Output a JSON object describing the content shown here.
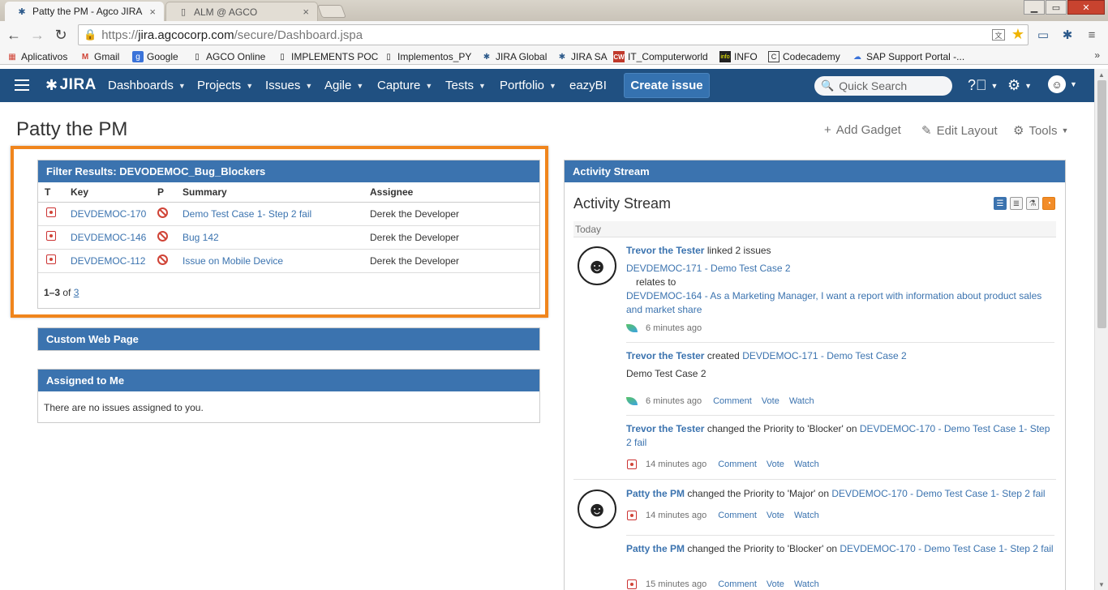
{
  "browser": {
    "tabs": [
      {
        "title": "Patty the PM - Agco JIRA",
        "close": "×"
      },
      {
        "title": "ALM @ AGCO",
        "close": "×"
      }
    ],
    "url": {
      "scheme": "https://",
      "host": "jira.agcocorp.com",
      "path": "/secure/Dashboard.jspa"
    },
    "bookmarks": [
      {
        "label": "Aplicativos",
        "icon": "apps-grid-icon"
      },
      {
        "label": "Gmail",
        "icon": "gmail-icon"
      },
      {
        "label": "Google",
        "icon": "google-icon"
      },
      {
        "label": "AGCO Online",
        "icon": "page-icon"
      },
      {
        "label": "IMPLEMENTS POC",
        "icon": "page-icon"
      },
      {
        "label": "Implementos_PY",
        "icon": "page-icon"
      },
      {
        "label": "JIRA Global",
        "icon": "jira-icon"
      },
      {
        "label": "JIRA SA",
        "icon": "jira-icon"
      },
      {
        "label": "IT_Computerworld",
        "icon": "cw-icon"
      },
      {
        "label": "INFO",
        "icon": "info-icon"
      },
      {
        "label": "Codecademy",
        "icon": "codecademy-icon"
      },
      {
        "label": "SAP Support Portal -...",
        "icon": "sap-icon"
      }
    ],
    "bookmarks_more": "»"
  },
  "jira": {
    "logo": "JIRA",
    "nav": [
      "Dashboards",
      "Projects",
      "Issues",
      "Agile",
      "Capture",
      "Tests",
      "Portfolio",
      "eazyBI"
    ],
    "create_button": "Create issue",
    "search_placeholder": "Quick Search"
  },
  "dashboard": {
    "title": "Patty the PM",
    "tools": {
      "add_gadget": "Add Gadget",
      "edit_layout": "Edit Layout",
      "tools": "Tools"
    }
  },
  "filter_gadget": {
    "title": "Filter Results: DEVODEMOC_Bug_Blockers",
    "columns": {
      "type": "T",
      "key": "Key",
      "priority": "P",
      "summary": "Summary",
      "assignee": "Assignee"
    },
    "rows": [
      {
        "key": "DEVDEMOC-170",
        "summary": "Demo Test Case 1- Step 2 fail",
        "assignee": "Derek the Developer"
      },
      {
        "key": "DEVDEMOC-146",
        "summary": "Bug 142",
        "assignee": "Derek the Developer"
      },
      {
        "key": "DEVDEMOC-112",
        "summary": "Issue on Mobile Device",
        "assignee": "Derek the Developer"
      }
    ],
    "pager": {
      "range": "1–3",
      "of": "of",
      "total": "3"
    }
  },
  "custom_web_gadget": {
    "title": "Custom Web Page"
  },
  "assigned_gadget": {
    "title": "Assigned to Me",
    "empty": "There are no issues assigned to you."
  },
  "activity": {
    "gadget_title": "Activity Stream",
    "heading": "Activity Stream",
    "today": "Today",
    "actions": {
      "comment": "Comment",
      "vote": "Vote",
      "watch": "Watch"
    },
    "entries": [
      {
        "user": "Trevor the Tester",
        "verb": "linked 2 issues",
        "link1": "DEVDEMOC-171 - Demo Test Case 2",
        "relates": "relates to",
        "link2": "DEVDEMOC-164 - As a Marketing Manager, I want a report with information about product sales and market share",
        "time": "6 minutes ago"
      },
      {
        "user": "Trevor the Tester",
        "verb": "created",
        "link": "DEVDEMOC-171 - Demo Test Case 2",
        "body": "Demo Test Case 2",
        "time": "6 minutes ago"
      },
      {
        "user": "Trevor the Tester",
        "verb": "changed the Priority to 'Blocker' on",
        "link": "DEVDEMOC-170 - Demo Test Case 1- Step 2 fail",
        "time": "14 minutes ago"
      },
      {
        "user": "Patty the PM",
        "verb": "changed the Priority to 'Major' on",
        "link": "DEVDEMOC-170 - Demo Test Case 1- Step 2 fail",
        "time": "14 minutes ago"
      },
      {
        "user": "Patty the PM",
        "verb": "changed the Priority to 'Blocker' on",
        "link": "DEVDEMOC-170 - Demo Test Case 1- Step 2 fail",
        "time": "15 minutes ago"
      }
    ]
  },
  "colors": {
    "header": "#205081",
    "gadget_title": "#3b73af",
    "highlight": "#f0851c",
    "link": "#3b73af"
  }
}
